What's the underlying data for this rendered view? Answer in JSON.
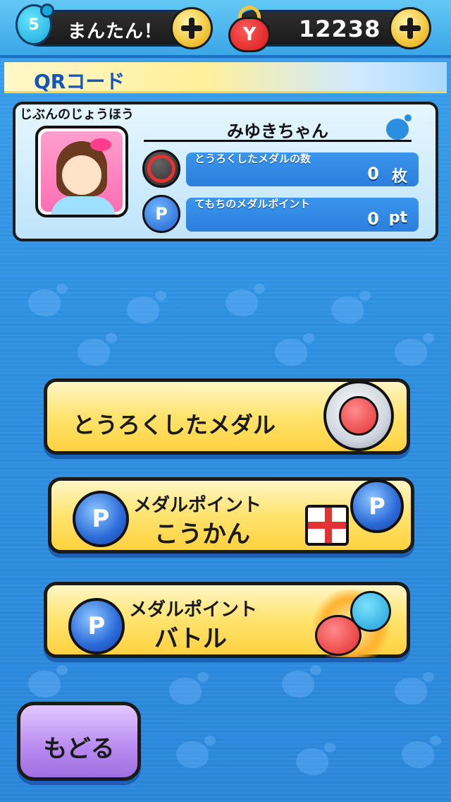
{
  "topbar": {
    "level": "5",
    "difficulty": "まんたん！",
    "money_icon_letter": "Y",
    "money": "12238"
  },
  "qr": {
    "title": "QRコード"
  },
  "profile": {
    "heading": "じぶんのじょうほう",
    "name": "みゆきちゃん",
    "stats": [
      {
        "label": "とうろくしたメダルの数",
        "value": "0",
        "unit": "枚",
        "icon": "medal-icon"
      },
      {
        "label": "てもちのメダルポイント",
        "value": "0",
        "unit": "pt",
        "icon": "p-coin-icon",
        "icon_letter": "P"
      }
    ]
  },
  "menu": {
    "registered_medals": "とうろくしたメダル",
    "exchange_line1": "メダルポイント",
    "exchange_line2": "こうかん",
    "battle_line1": "メダルポイント",
    "battle_line2": "バトル",
    "coin_letter": "P"
  },
  "back": {
    "label": "もどる"
  },
  "colors": {
    "background": "#2a8fe0",
    "button_yellow": "#ffe36e",
    "back_purple": "#b78af0",
    "accent_blue": "#1655b8"
  }
}
